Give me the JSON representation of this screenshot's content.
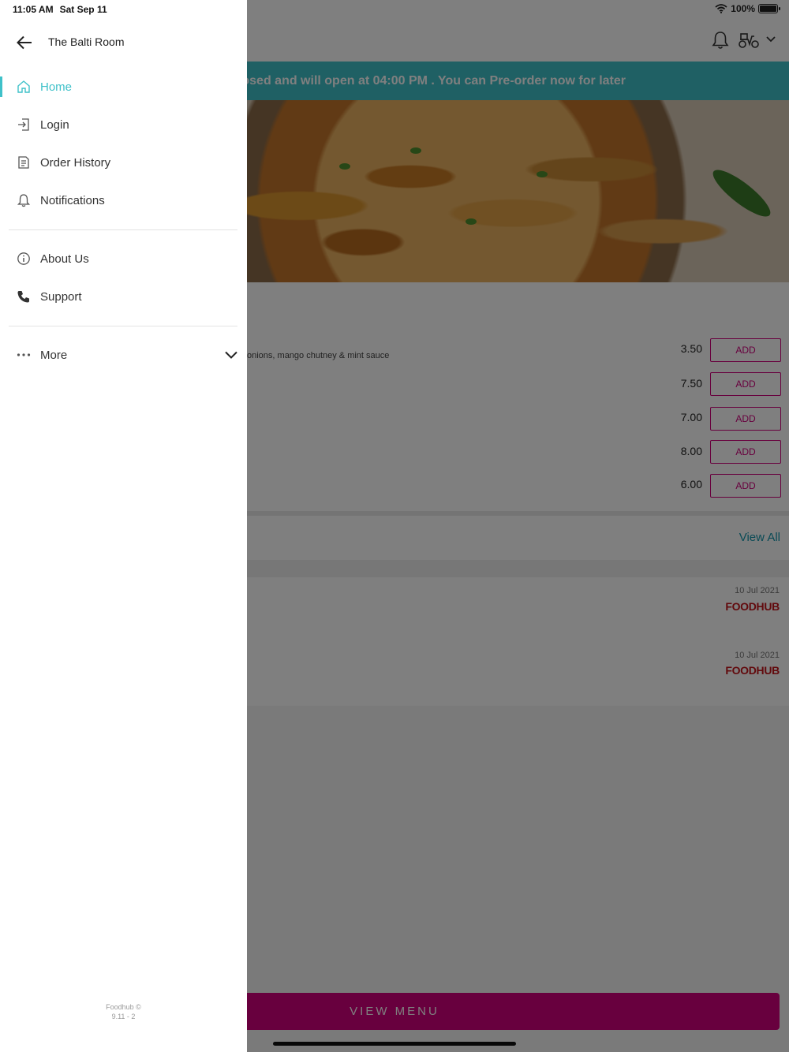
{
  "status_bar": {
    "time": "11:05 AM",
    "date": "Sat Sep 11",
    "battery": "100%"
  },
  "drawer": {
    "title": "The Balti Room",
    "items": [
      {
        "label": "Home",
        "icon": "home-icon",
        "active": true
      },
      {
        "label": "Login",
        "icon": "login-icon"
      },
      {
        "label": "Order History",
        "icon": "receipt-icon"
      },
      {
        "label": "Notifications",
        "icon": "bell-icon"
      }
    ],
    "info_items": [
      {
        "label": "About Us",
        "icon": "info-icon"
      },
      {
        "label": "Support",
        "icon": "phone-icon"
      }
    ],
    "more_label": "More",
    "footer_line1": "Foodhub ©",
    "footer_line2": "9.11 - 2"
  },
  "background": {
    "banner_text": "osed and will open at 04:00 PM . You can Pre-order now for later",
    "item_description": "onions, mango chutney & mint sauce",
    "prices": [
      "3.50",
      "7.50",
      "7.00",
      "8.00",
      "6.00"
    ],
    "add_label": "ADD",
    "view_all_label": "View All",
    "reviews": [
      {
        "date": "10 Jul 2021",
        "source": "FOODHUB"
      },
      {
        "date": "10 Jul 2021",
        "source": "FOODHUB"
      }
    ],
    "view_menu_label": "VIEW MENU"
  },
  "colors": {
    "accent_teal": "#3fc1c9",
    "brand_magenta": "#d0007c",
    "overlay": "rgba(0,0,0,0.5)"
  }
}
